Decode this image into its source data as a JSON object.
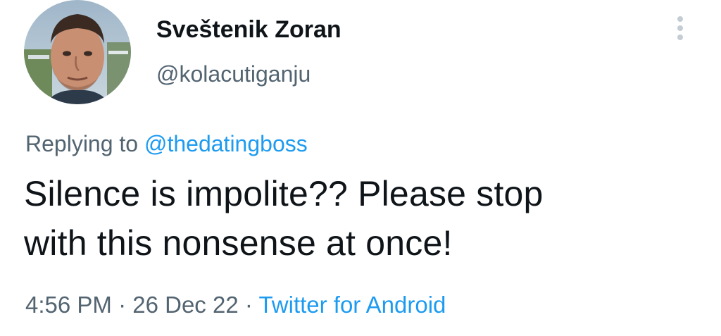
{
  "tweet": {
    "author": {
      "display_name": "Sveštenik Zoran",
      "handle": "@kolacutiganju",
      "avatar": "profile-photo"
    },
    "more_icon": "more-vertical-icon",
    "reply_prefix": "Replying to",
    "reply_to": "@thedatingboss",
    "text_line1": "Silence is impolite?? Please stop",
    "text_line2": "with this nonsense at once!",
    "time": "4:56 PM",
    "separator": "·",
    "date": "26 Dec 22",
    "source": "Twitter for Android"
  },
  "colors": {
    "primary_text": "#0f1419",
    "secondary_text": "#536471",
    "link": "#1d9bf0"
  }
}
